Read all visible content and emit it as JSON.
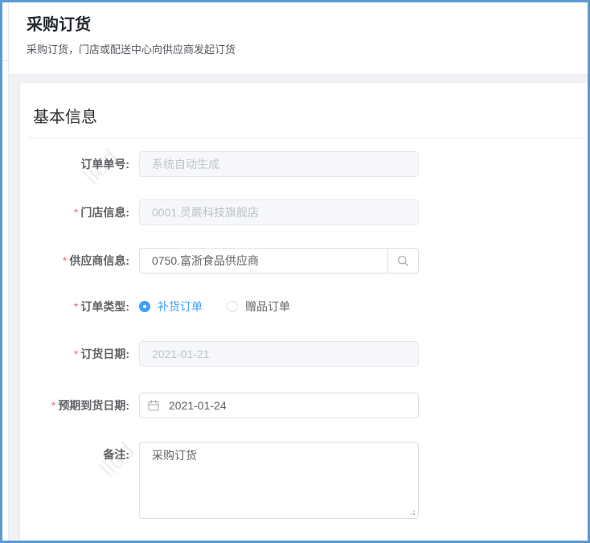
{
  "header": {
    "title": "采购订货",
    "subtitle": "采购订货，门店或配送中心向供应商发起订货"
  },
  "section": {
    "title": "基本信息"
  },
  "form": {
    "order_no": {
      "label": "订单单号:",
      "placeholder": "系统自动生成"
    },
    "store": {
      "label": "门店信息:",
      "required_mark": "*",
      "value": "0001.灵蕨科技旗舰店"
    },
    "supplier": {
      "label": "供应商信息:",
      "required_mark": "*",
      "value": "0750.富浙食品供应商",
      "append_icon": "search-icon"
    },
    "order_type": {
      "label": "订单类型:",
      "required_mark": "*",
      "options": [
        {
          "label": "补货订单",
          "selected": true
        },
        {
          "label": "赠品订单",
          "selected": false
        }
      ]
    },
    "order_date": {
      "label": "订货日期:",
      "required_mark": "*",
      "value": "2021-01-21"
    },
    "expected_date": {
      "label": "预期到货日期:",
      "required_mark": "*",
      "value": "2021-01-24",
      "icon": "calendar-icon"
    },
    "remark": {
      "label": "备注:",
      "value": "采购订货"
    }
  },
  "watermark": {
    "text": "lldd"
  },
  "colors": {
    "accent": "#409eff",
    "required": "#f56c6c",
    "frame_border": "#5b9bd5",
    "page_background": "#f0f2f5"
  }
}
